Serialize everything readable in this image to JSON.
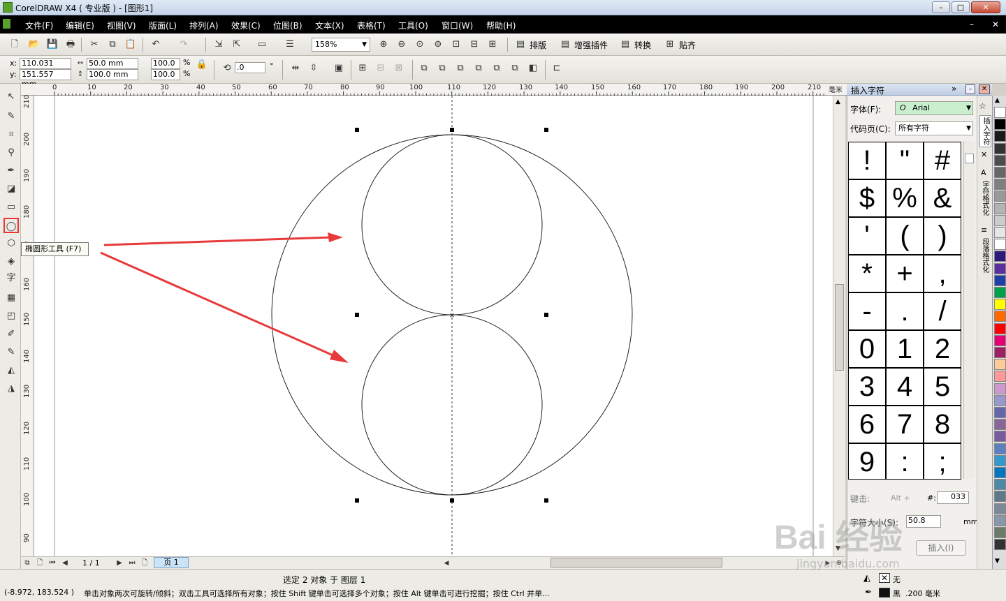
{
  "window": {
    "title": "CorelDRAW X4 ( 专业版 ) - [图形1]",
    "buttons": [
      "–",
      "□",
      "✕"
    ]
  },
  "menubar": {
    "items": [
      "文件(F)",
      "编辑(E)",
      "视图(V)",
      "版面(L)",
      "排列(A)",
      "效果(C)",
      "位图(B)",
      "文本(X)",
      "表格(T)",
      "工具(O)",
      "窗口(W)",
      "帮助(H)"
    ],
    "doc_buttons": [
      "–",
      "✕"
    ]
  },
  "standard_toolbar": {
    "zoom": "158%",
    "plugins": [
      "排版",
      "增强插件",
      "转换",
      "贴齐"
    ]
  },
  "property_bar": {
    "x": "110.031 mm",
    "y": "151.557 mm",
    "width": "50.0 mm",
    "height": "100.0 mm",
    "scale_x": "100.0",
    "scale_y": "100.0",
    "percent": "%",
    "rotation": ".0",
    "degree": "°"
  },
  "ruler": {
    "top_ticks": [
      "0",
      "10",
      "20",
      "30",
      "40",
      "50",
      "60",
      "70",
      "80",
      "90",
      "100",
      "110",
      "120",
      "130",
      "140",
      "150",
      "160",
      "170",
      "180",
      "190",
      "200",
      "210"
    ],
    "units": "毫米",
    "left_ticks": [
      "210",
      "200",
      "190",
      "180",
      "170",
      "160",
      "150",
      "140",
      "130",
      "120",
      "110",
      "100",
      "90"
    ]
  },
  "toolbox": {
    "tooltip": "椭圆形工具 (F7)",
    "text_tool_glyph": "字"
  },
  "page_nav": {
    "counter": "1 / 1",
    "tab": "页 1"
  },
  "panel": {
    "title": "插入字符",
    "font_label": "字体(F):",
    "font_value": "Arial",
    "codepage_label": "代码页(C):",
    "codepage_value": "所有字符",
    "characters": [
      "!",
      "\"",
      "#",
      "$",
      "%",
      "&",
      "'",
      "(",
      ")",
      "*",
      "+",
      ",",
      "-",
      ".",
      "/",
      "0",
      "1",
      "2",
      "3",
      "4",
      "5",
      "6",
      "7",
      "8",
      "9",
      ":",
      ";"
    ],
    "keystroke_label": "键击:",
    "alt_label": "Alt +",
    "hash_label": "#:",
    "code_value": "033",
    "size_label": "字符大小(S):",
    "size_value": "50.8",
    "size_unit": "mm",
    "insert_button": "插入(I)"
  },
  "dock_tabs": [
    "插入字符",
    "字符格式化",
    "段落格式化"
  ],
  "palette_colors": [
    "#ffffff",
    "#000000",
    "#1a1a1a",
    "#333333",
    "#4d4d4d",
    "#666666",
    "#808080",
    "#999999",
    "#b3b3b3",
    "#cccccc",
    "#e6e6e6",
    "#ffffff",
    "#2e1a7a",
    "#5b2fa0",
    "#1e3fa8",
    "#00a04a",
    "#ffff00",
    "#ff6a00",
    "#ff0000",
    "#e60073",
    "#9e1f63",
    "#ffcc99",
    "#ff9999",
    "#cc99cc",
    "#9999cc",
    "#6666aa",
    "#886699",
    "#7a5aa0",
    "#5b7fbf",
    "#3399cc",
    "#0077c0",
    "#4d8aa8",
    "#5e7a8a",
    "#7a8a99",
    "#8899a8",
    "#6b7b6b",
    "#333333"
  ],
  "statusbar": {
    "coords": "(-8.972, 183.524 )",
    "selection": "选定 2 对象 于 图层 1",
    "hint": "单击对象两次可旋转/倾斜；双击工具可选择所有对象；按住 Shift 键单击可选择多个对象；按住 Alt 键单击可进行挖掘；按住 Ctrl 并单...",
    "fill_label": "无",
    "outline_label": "黑",
    "outline_width": ".200 毫米"
  },
  "watermark": {
    "brand": "Bai 经验",
    "url": "jingyan.baidu.com"
  }
}
